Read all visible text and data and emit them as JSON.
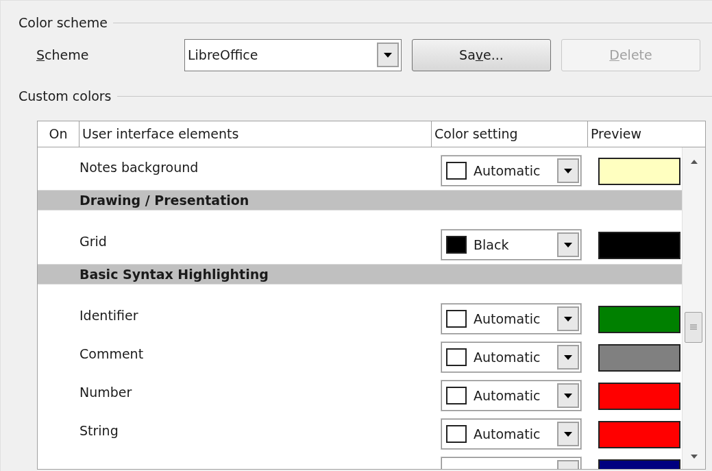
{
  "color_scheme": {
    "title": "Color scheme",
    "label": [
      {
        "text": "S",
        "underlined": true
      },
      {
        "text": "cheme",
        "underlined": false
      }
    ],
    "scheme": "LibreOffice",
    "buttons": [
      {
        "label": [
          {
            "text": "Sa",
            "underlined": false
          },
          {
            "text": "v",
            "underlined": true
          },
          {
            "text": "e...",
            "underlined": false
          }
        ],
        "disabled": false
      },
      {
        "label": [
          {
            "text": "D",
            "underlined": true
          },
          {
            "text": "elete",
            "underlined": false
          }
        ],
        "disabled": true
      }
    ]
  },
  "custom_colors": {
    "title": "Custom colors",
    "columns": [
      "On",
      "User interface elements",
      "Color setting",
      "Preview"
    ],
    "rows": [
      {
        "kind": "item",
        "label": "Notes background",
        "setting": "Automatic",
        "swatch_filled": false,
        "color": "#ffffc0"
      },
      {
        "kind": "category",
        "label": "Drawing / Presentation"
      },
      {
        "kind": "item",
        "label": "Grid",
        "setting": "Black",
        "swatch_filled": true,
        "color": "#000000"
      },
      {
        "kind": "category",
        "label": "Basic Syntax Highlighting"
      },
      {
        "kind": "item",
        "label": "Identifier",
        "setting": "Automatic",
        "swatch_filled": false,
        "color": "#008000"
      },
      {
        "kind": "item",
        "label": "Comment",
        "setting": "Automatic",
        "swatch_filled": false,
        "color": "#808080"
      },
      {
        "kind": "item",
        "label": "Number",
        "setting": "Automatic",
        "swatch_filled": false,
        "color": "#ff0000"
      },
      {
        "kind": "item",
        "label": "String",
        "setting": "Automatic",
        "swatch_filled": false,
        "color": "#ff0000"
      },
      {
        "kind": "partial",
        "color": "#000080"
      }
    ]
  }
}
